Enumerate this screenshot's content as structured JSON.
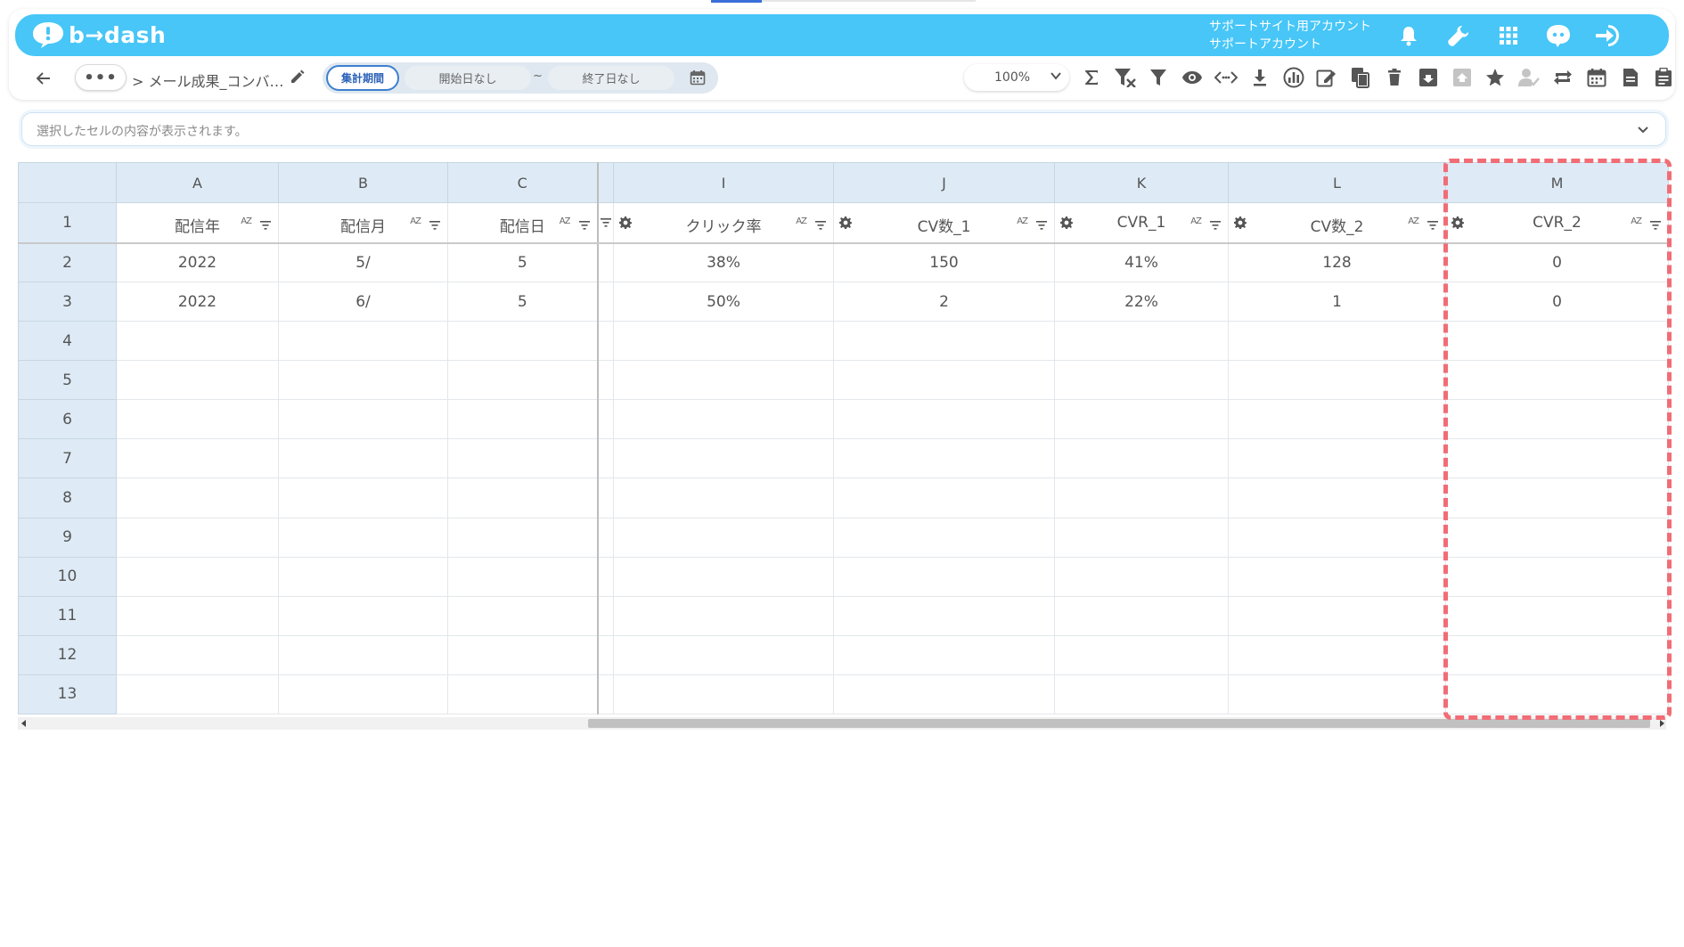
{
  "app": {
    "logo_text": "b→dash",
    "account_line1": "サポートサイト用アカウント",
    "account_line2": "サポートアカウント",
    "brand_color": "#47c6f7",
    "header_icons": [
      "bell-icon",
      "wrench-icon",
      "apps-grid-icon",
      "chat-bot-icon",
      "logout-icon"
    ]
  },
  "toolbar": {
    "more_label": "•••",
    "breadcrumb": "> メール成果_コンバ…",
    "period_label": "集計期間",
    "period_start": "開始日なし",
    "period_tilde": "~",
    "period_end": "終了日なし",
    "zoom_value": "100%",
    "tools": [
      "sum-icon",
      "filter-clear-icon",
      "filter-icon",
      "eye-icon",
      "code-icon",
      "download-icon",
      "chart-icon",
      "edit-note-icon",
      "copy-icon",
      "delete-icon",
      "archive-icon",
      "upload-icon",
      "star-icon",
      "user-check-icon",
      "repeat-icon",
      "calendar-icon",
      "document-icon",
      "clipboard-icon"
    ]
  },
  "cellbar": {
    "placeholder": "選択したセルの内容が表示されます。"
  },
  "grid": {
    "columns": [
      "A",
      "B",
      "C",
      "I",
      "J",
      "K",
      "L",
      "M"
    ],
    "fields": [
      "配信年",
      "配信月",
      "配信日",
      "クリック率",
      "CV数_1",
      "CVR_1",
      "CV数_2",
      "CVR_2"
    ],
    "sort_label": "AZ",
    "rows": [
      {
        "n": "1"
      },
      {
        "n": "2",
        "cells": [
          "2022",
          "5/",
          "5",
          "38%",
          "150",
          "41%",
          "128",
          "0"
        ]
      },
      {
        "n": "3",
        "cells": [
          "2022",
          "6/",
          "5",
          "50%",
          "2",
          "22%",
          "1",
          "0"
        ]
      },
      {
        "n": "4"
      },
      {
        "n": "5"
      },
      {
        "n": "6"
      },
      {
        "n": "7"
      },
      {
        "n": "8"
      },
      {
        "n": "9"
      },
      {
        "n": "10"
      },
      {
        "n": "11"
      },
      {
        "n": "12"
      },
      {
        "n": "13"
      }
    ]
  },
  "highlight_color": "#f16d76"
}
